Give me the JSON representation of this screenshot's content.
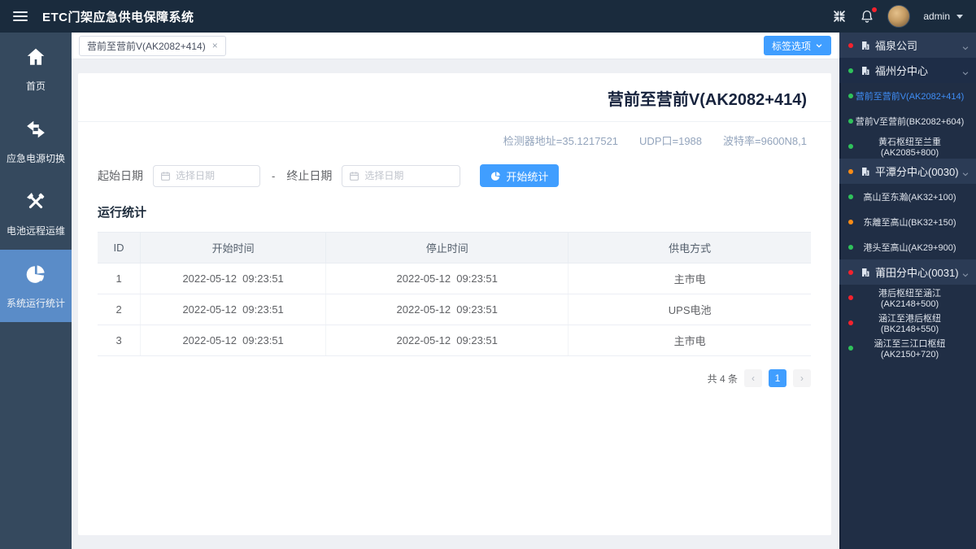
{
  "topbar": {
    "title": "ETC门架应急供电保障系统",
    "user": "admin"
  },
  "left_nav": {
    "items": [
      {
        "label": "首页",
        "icon": "home-icon"
      },
      {
        "label": "应急电源切换",
        "icon": "switch-arrows-icon"
      },
      {
        "label": "电池远程运维",
        "icon": "tools-icon"
      },
      {
        "label": "系统运行统计",
        "icon": "pie-chart-icon"
      }
    ]
  },
  "tabbar": {
    "active_tab": "营前至营前V(AK2082+414)",
    "close": "×",
    "options_button": "标签选项"
  },
  "main": {
    "title": "营前至营前V(AK2082+414)",
    "meta": {
      "detector": "检测器地址=35.1217521",
      "udp": "UDP口=1988",
      "baud": "波特率=9600N8,1"
    },
    "form": {
      "start_label": "起始日期",
      "separator": "-",
      "end_label": "终止日期",
      "date_placeholder": "选择日期",
      "submit_label": "开始统计"
    },
    "section_title": "运行统计",
    "table": {
      "headers": [
        "ID",
        "开始时间",
        "停止时间",
        "供电方式"
      ],
      "rows": [
        [
          "1",
          "2022-05-12  09:23:51",
          "2022-05-12  09:23:51",
          "主市电"
        ],
        [
          "2",
          "2022-05-12  09:23:51",
          "2022-05-12  09:23:51",
          "UPS电池"
        ],
        [
          "3",
          "2022-05-12  09:23:51",
          "2022-05-12  09:23:51",
          "主市电"
        ]
      ]
    },
    "pagination": {
      "total": "共 4 条",
      "prev": "‹",
      "page": "1",
      "next": "›"
    }
  },
  "tree": {
    "items": [
      {
        "label": "福泉公司",
        "dot": "red",
        "type": "group"
      },
      {
        "label": "福州分中心",
        "dot": "green",
        "type": "group"
      },
      {
        "label": "营前至营前V(AK2082+414)",
        "dot": "green",
        "type": "leaf",
        "selected": true
      },
      {
        "label": "营前V至营前(BK2082+604)",
        "dot": "green",
        "type": "leaf"
      },
      {
        "label": "黄石枢纽至兰重(AK2085+800)",
        "dot": "green",
        "type": "leaf"
      },
      {
        "label": "平潭分中心(0030)",
        "dot": "orange",
        "type": "group"
      },
      {
        "label": "高山至东瀚(AK32+100)",
        "dot": "green",
        "type": "leaf"
      },
      {
        "label": "东離至高山(BK32+150)",
        "dot": "orange",
        "type": "leaf"
      },
      {
        "label": "港头至高山(AK29+900)",
        "dot": "green",
        "type": "leaf"
      },
      {
        "label": "莆田分中心(0031)",
        "dot": "red",
        "type": "group"
      },
      {
        "label": "港后枢纽至涵江(AK2148+500)",
        "dot": "red",
        "type": "leaf"
      },
      {
        "label": "涵江至港后枢纽(BK2148+550)",
        "dot": "red",
        "type": "leaf"
      },
      {
        "label": "涵江至三江口枢纽(AK2150+720)",
        "dot": "green",
        "type": "leaf"
      }
    ]
  },
  "colors": {
    "accent": "#409eff",
    "topbar_bg": "#1a2b3d",
    "left_rail_bg": "#35495e",
    "active_nav_bg": "#5a8cc8",
    "right_sidebar_bg": "#202e45",
    "dot_red": "#f5222d",
    "dot_green": "#2fc25b",
    "dot_orange": "#fa8c16",
    "selected_tree_text": "#3f8ef6"
  }
}
